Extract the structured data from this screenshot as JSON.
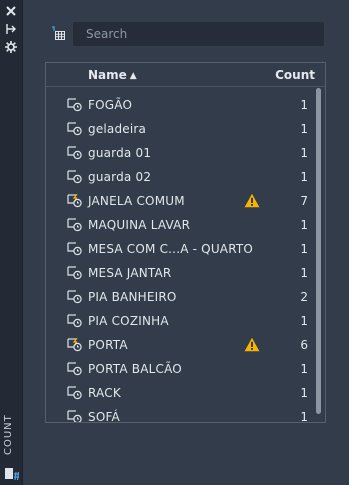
{
  "sidebar": {
    "title": "COUNT",
    "close_icon": "close-icon",
    "pin_icon": "pin-icon",
    "settings_icon": "gear-icon"
  },
  "search": {
    "placeholder": "Search",
    "value": ""
  },
  "table": {
    "headers": {
      "name": "Name",
      "count": "Count",
      "sort": "ascending"
    },
    "rows": [
      {
        "name": "FOGÃO",
        "count": "1",
        "warning": false,
        "dynamic": false
      },
      {
        "name": "geladeira",
        "count": "1",
        "warning": false,
        "dynamic": false
      },
      {
        "name": "guarda 01",
        "count": "1",
        "warning": false,
        "dynamic": false
      },
      {
        "name": "guarda 02",
        "count": "1",
        "warning": false,
        "dynamic": false
      },
      {
        "name": "JANELA COMUM",
        "count": "7",
        "warning": true,
        "dynamic": true
      },
      {
        "name": "MAQUINA LAVAR",
        "count": "1",
        "warning": false,
        "dynamic": false
      },
      {
        "name": "MESA COM C...A - QUARTO",
        "count": "1",
        "warning": false,
        "dynamic": false
      },
      {
        "name": "MESA JANTAR",
        "count": "1",
        "warning": false,
        "dynamic": false
      },
      {
        "name": "PIA BANHEIRO",
        "count": "2",
        "warning": false,
        "dynamic": false
      },
      {
        "name": "PIA COZINHA",
        "count": "1",
        "warning": false,
        "dynamic": false
      },
      {
        "name": "PORTA",
        "count": "6",
        "warning": true,
        "dynamic": true
      },
      {
        "name": "PORTA BALCÃO",
        "count": "1",
        "warning": false,
        "dynamic": false
      },
      {
        "name": "RACK",
        "count": "1",
        "warning": false,
        "dynamic": false
      },
      {
        "name": "SOFÁ",
        "count": "1",
        "warning": false,
        "dynamic": false
      }
    ]
  },
  "colors": {
    "panel_bg": "#333c4a",
    "sidebar_bg": "#232a35",
    "warning": "#f5b400",
    "text": "#e3e7ec"
  }
}
